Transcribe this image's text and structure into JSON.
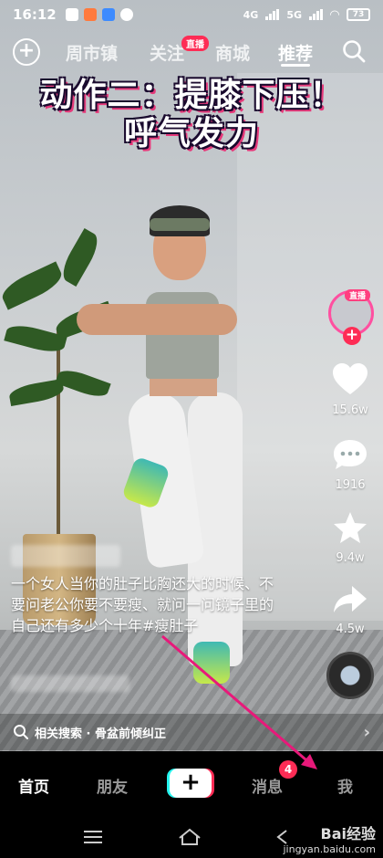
{
  "status_bar": {
    "time": "16:12",
    "signal1": "4G",
    "signal2": "5G",
    "battery": "73"
  },
  "top_nav": {
    "tabs": [
      "周市镇",
      "关注",
      "商城",
      "推荐"
    ],
    "active_tab": "推荐",
    "live_badge": "直播"
  },
  "video": {
    "caption_line1": "动作二：提膝下压！",
    "caption_line2": "呼气发力"
  },
  "right_rail": {
    "avatar_live_label": "直播",
    "likes": "15.6w",
    "comments": "1916",
    "favorites": "9.4w",
    "shares": "4.5w"
  },
  "description": {
    "text": "一个女人当你的肚子比胸还大的时候、不要问老公你要不要瘦、就问一问镜子里的自己还有多少个十年#瘦肚子"
  },
  "related_search": {
    "label": "相关搜索 · 骨盆前倾纠正"
  },
  "bottom_nav": {
    "home": "首页",
    "friends": "朋友",
    "create": "+",
    "messages": "消息",
    "messages_badge": "4",
    "me": "我"
  },
  "watermark": {
    "line1": "Bai经验",
    "line2": "jingyan.baidu.com"
  },
  "colors": {
    "accent": "#fe2c55",
    "cyan": "#25f4ee",
    "arrow": "#e8197a"
  }
}
